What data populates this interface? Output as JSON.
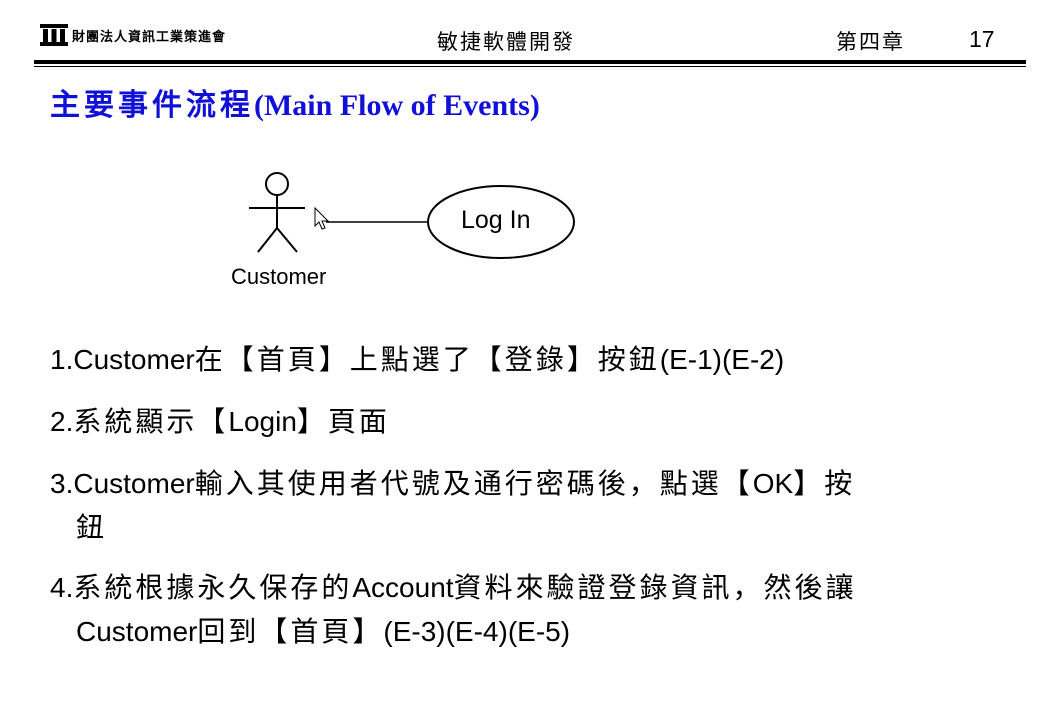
{
  "header": {
    "org_name": "財團法人資訊工業策進會",
    "course": "敏捷軟體開發",
    "chapter": "第四章",
    "page_number": "17"
  },
  "title": {
    "zh": "主要事件流程",
    "en": "(Main Flow of Events)"
  },
  "diagram": {
    "actor": "Customer",
    "use_case": "Log In"
  },
  "steps": [
    {
      "num": "1.",
      "lead": "Customer",
      "text": "在【首頁】上點選了【登錄】按鈕",
      "tail": "(E-1)(E-2)"
    },
    {
      "num": "2.",
      "text_a": "系統顯示【",
      "mid": "Login",
      "text_b": "】頁面"
    },
    {
      "num": "3.",
      "lead": "Customer",
      "text_a": "輸入其使用者代號及通行密碼後，點選【",
      "mid": "OK",
      "text_b": "】按",
      "wrap": "鈕"
    },
    {
      "num": "4.",
      "text_a": "系統根據永久保存的",
      "mid": "Account",
      "text_b": "資料來驗證登錄資訊，然後讓",
      "wrap_lead": "Customer",
      "wrap_text": "回到【首頁】",
      "wrap_tail": "(E-3)(E-4)(E-5)"
    }
  ]
}
